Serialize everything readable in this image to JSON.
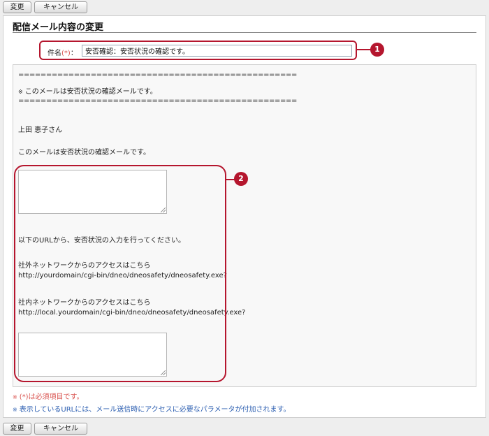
{
  "toolbar": {
    "change_label": "変更",
    "cancel_label": "キャンセル"
  },
  "form": {
    "title": "配信メール内容の変更",
    "subject_label": "件名",
    "required_mark": "(*)",
    "subject_colon": "：",
    "subject_value": "安否確認：安否状況の確認です。"
  },
  "body": {
    "separator": "==================================================",
    "header_mark": "※",
    "header_text": "このメールは安否状況の確認メールです。",
    "recipient": "上田 恵子さん",
    "intro": "このメールは安否状況の確認メールです。",
    "instruction": "以下のURLから、安否状況の入力を行ってください。",
    "external_label": "社外ネットワークからのアクセスはこちら",
    "external_url": "http://yourdomain/cgi-bin/dneo/dneosafety/dneosafety.exe?",
    "internal_label": "社内ネットワークからのアクセスはこちら",
    "internal_url": "http://local.yourdomain/cgi-bin/dneo/dneosafety/dneosafety.exe?"
  },
  "callouts": {
    "one": "1",
    "two": "2"
  },
  "notes": {
    "mark": "※",
    "required": "(*)は必須項目です。",
    "url_note": "表示しているURLには、メール送信時にアクセスに必要なパラメータが付加されます。"
  },
  "colors": {
    "callout": "#b5162e",
    "required": "#d9534f",
    "note_blue": "#2a5db0"
  }
}
